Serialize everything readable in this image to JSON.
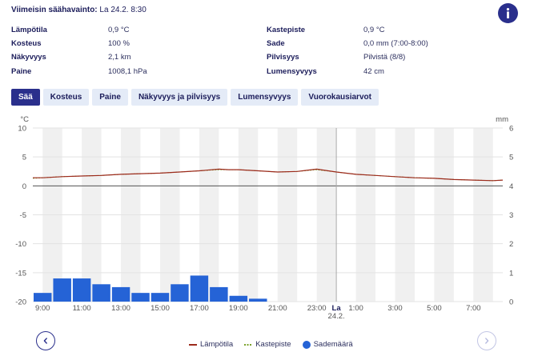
{
  "header": {
    "title_label": "Viimeisin säähavainto:",
    "timestamp": "La 24.2. 8:30",
    "info_icon": "info-icon"
  },
  "observations": [
    {
      "label": "Lämpötila",
      "value": "0,9 °C"
    },
    {
      "label": "Kosteus",
      "value": "100 %"
    },
    {
      "label": "Näkyvyys",
      "value": "2,1 km"
    },
    {
      "label": "Paine",
      "value": "1008,1 hPa"
    },
    {
      "label": "Kastepiste",
      "value": "0,9 °C"
    },
    {
      "label": "Sade",
      "value": "0,0 mm (7:00-8:00)"
    },
    {
      "label": "Pilvisyys",
      "value": "Pilvistä (8/8)"
    },
    {
      "label": "Lumensyvyys",
      "value": "42 cm"
    }
  ],
  "tabs": [
    {
      "label": "Sää",
      "active": true
    },
    {
      "label": "Kosteus",
      "active": false
    },
    {
      "label": "Paine",
      "active": false
    },
    {
      "label": "Näkyvyys ja pilvisyys",
      "active": false
    },
    {
      "label": "Lumensyvyys",
      "active": false
    },
    {
      "label": "Vuorokausiarvot",
      "active": false
    }
  ],
  "nav": {
    "prev_icon": "chevron-left-icon",
    "next_icon": "chevron-right-icon",
    "next_enabled": false
  },
  "chart_data": {
    "type": "line",
    "title": "",
    "grid": true,
    "y_left": {
      "unit": "°C",
      "ticks": [
        10,
        5,
        0,
        -5,
        -10,
        -15,
        -20
      ],
      "range": [
        -20,
        10
      ]
    },
    "y_right": {
      "unit": "mm",
      "ticks": [
        6,
        5,
        4,
        3,
        2,
        1,
        0
      ],
      "range": [
        0,
        6
      ]
    },
    "x_range_hours": [
      8.5,
      32.5
    ],
    "x_ticks": [
      {
        "hour": 9,
        "label": "9:00"
      },
      {
        "hour": 11,
        "label": "11:00"
      },
      {
        "hour": 13,
        "label": "13:00"
      },
      {
        "hour": 15,
        "label": "15:00"
      },
      {
        "hour": 17,
        "label": "17:00"
      },
      {
        "hour": 19,
        "label": "19:00"
      },
      {
        "hour": 21,
        "label": "21:00"
      },
      {
        "hour": 23,
        "label": "23:00"
      },
      {
        "hour": 24,
        "label": "La",
        "sublabel": "24.2.",
        "bold": true
      },
      {
        "hour": 25,
        "label": "1:00"
      },
      {
        "hour": 27,
        "label": "3:00"
      },
      {
        "hour": 29,
        "label": "5:00"
      },
      {
        "hour": 31,
        "label": "7:00"
      }
    ],
    "midnight_hour": 24,
    "series": [
      {
        "name": "Lämpötila",
        "axis": "left",
        "color": "#9c2a1c",
        "x": [
          8.5,
          9,
          10,
          11,
          12,
          13,
          14,
          15,
          16,
          17,
          18,
          18.5,
          19,
          20,
          21,
          22,
          23,
          24,
          25,
          26,
          27,
          28,
          29,
          30,
          31,
          32,
          32.5
        ],
        "y": [
          1.4,
          1.4,
          1.6,
          1.7,
          1.8,
          2.0,
          2.1,
          2.2,
          2.4,
          2.6,
          2.9,
          2.8,
          2.8,
          2.6,
          2.4,
          2.5,
          2.9,
          2.4,
          2.0,
          1.8,
          1.6,
          1.4,
          1.3,
          1.1,
          1.0,
          0.9,
          1.0
        ]
      },
      {
        "name": "Kastepiste",
        "axis": "left",
        "color": "#7ba32a",
        "x": [
          8.5,
          9,
          10,
          11,
          12,
          13,
          14,
          15,
          16,
          17,
          18,
          18.5,
          19,
          20,
          21,
          22,
          23,
          24,
          25,
          26,
          27,
          28,
          29,
          30,
          31,
          32,
          32.5
        ],
        "y": [
          1.3,
          1.4,
          1.6,
          1.7,
          1.8,
          2.0,
          2.1,
          2.2,
          2.4,
          2.6,
          2.8,
          2.8,
          2.8,
          2.6,
          2.4,
          2.5,
          2.8,
          2.4,
          2.0,
          1.8,
          1.6,
          1.4,
          1.3,
          1.1,
          1.0,
          0.9,
          1.0
        ]
      },
      {
        "name": "Sademäärä",
        "axis": "right",
        "type": "bar",
        "color": "#2563d6",
        "x": [
          8.5,
          9.5,
          10.5,
          11.5,
          12.5,
          13.5,
          14.5,
          15.5,
          16.5,
          17.5,
          18.5,
          19.5,
          20.5,
          21.5,
          22.5,
          23.5,
          24.5,
          25.5,
          26.5,
          27.5,
          28.5,
          29.5,
          30.5,
          31.5
        ],
        "values": [
          0.3,
          0.8,
          0.8,
          0.6,
          0.5,
          0.3,
          0.3,
          0.6,
          0.9,
          0.5,
          0.2,
          0.1,
          0,
          0,
          0,
          0,
          0,
          0,
          0,
          0,
          0,
          0,
          0,
          0
        ]
      }
    ]
  }
}
